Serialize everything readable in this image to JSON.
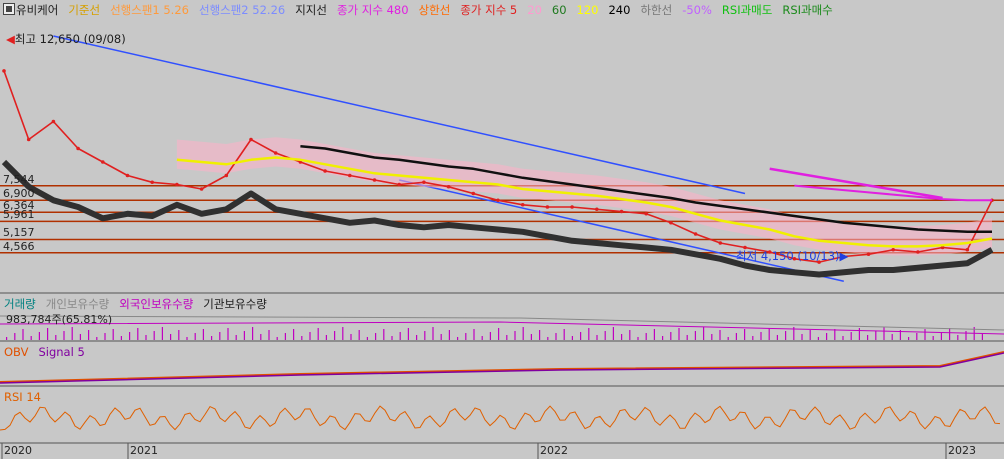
{
  "legend_main": [
    {
      "label": "유비케어",
      "color": "#202020"
    },
    {
      "label": "기준선",
      "color": "#d6a000"
    },
    {
      "label": "선행스팬1 5.26",
      "color": "#ff9a3c"
    },
    {
      "label": "선행스팬2 52.26",
      "color": "#7c8cff"
    },
    {
      "label": "지지선",
      "color": "#202020"
    },
    {
      "label": "종가 지수 480",
      "color": "#e020e0"
    },
    {
      "label": "상한선",
      "color": "#ff6a00"
    },
    {
      "label": "종가 지수 5",
      "color": "#e02020"
    },
    {
      "label": "20",
      "color": "#ff9ad0"
    },
    {
      "label": "60",
      "color": "#1f7a1f"
    },
    {
      "label": "120",
      "color": "#ffff00"
    },
    {
      "label": "240",
      "color": "#000000"
    },
    {
      "label": "하한선",
      "color": "#777777"
    },
    {
      "label": "-50%",
      "color": "#c060ff"
    },
    {
      "label": "RSI과매도",
      "color": "#10c010"
    },
    {
      "label": "RSI과매수",
      "color": "#1a8a1a"
    }
  ],
  "price_levels": [
    "7,544",
    "6,900",
    "6,364",
    "5,961",
    "5,157",
    "4,566"
  ],
  "annotation_high": "최고 12,650 (09/08)",
  "annotation_low": "최저 4,150 (10/13)",
  "legend_volume": [
    {
      "label": "거래량",
      "color": "#008080"
    },
    {
      "label": "개인보유수량",
      "color": "#888888"
    },
    {
      "label": "외국인보유수량",
      "color": "#c000c0"
    },
    {
      "label": "기관보유수량",
      "color": "#202020"
    }
  ],
  "volume_value": "983,784주(65.81%)",
  "legend_obv": [
    {
      "label": "OBV",
      "color": "#e05000"
    },
    {
      "label": "Signal 5",
      "color": "#8000a0"
    }
  ],
  "legend_rsi": [
    {
      "label": "RSI 14",
      "color": "#e06000"
    }
  ],
  "x_axis_labels": [
    "2020",
    "2021",
    "2022",
    "2023"
  ],
  "colors": {
    "background": "#c8c8c8",
    "price_up": "#e02020",
    "price_down": "#2040e0",
    "trend_line": "#3050ff",
    "level_line": "#b03000"
  },
  "chart_data": {
    "type": "line",
    "title": "유비케어",
    "x_axis": [
      "2020",
      "2021",
      "2022",
      "2023"
    ],
    "series": [
      {
        "name": "종가",
        "values": [
          12650,
          9600,
          10400,
          9200,
          8600,
          8000,
          7700,
          7600,
          7400,
          8000,
          9600,
          9000,
          8600,
          8200,
          8000,
          7800,
          7600,
          7700,
          7500,
          7200,
          6900,
          6700,
          6600,
          6600,
          6500,
          6400,
          6300,
          5900,
          5400,
          5000,
          4800,
          4600,
          4300,
          4150,
          4400,
          4500,
          4700,
          4600,
          4800,
          4700,
          6900
        ]
      },
      {
        "name": "240",
        "values": [
          null,
          null,
          null,
          null,
          null,
          null,
          null,
          null,
          null,
          null,
          null,
          null,
          9300,
          9200,
          9000,
          8800,
          8700,
          8550,
          8400,
          8300,
          8100,
          7900,
          7750,
          7600,
          7450,
          7300,
          7150,
          7000,
          6800,
          6650,
          6500,
          6350,
          6200,
          6050,
          5900,
          5800,
          5700,
          5600,
          5550,
          5500,
          5500
        ]
      },
      {
        "name": "120",
        "values": [
          null,
          null,
          null,
          null,
          null,
          null,
          null,
          8700,
          8600,
          8500,
          8700,
          8800,
          8700,
          8500,
          8300,
          8100,
          8000,
          7900,
          7800,
          7700,
          7600,
          7400,
          7300,
          7200,
          7100,
          6950,
          6800,
          6600,
          6300,
          6000,
          5800,
          5600,
          5300,
          5100,
          5000,
          4900,
          4850,
          4850,
          4900,
          5000,
          5200
        ]
      },
      {
        "name": "종가 지수 480",
        "values": [
          null,
          null,
          null,
          null,
          null,
          null,
          null,
          null,
          null,
          null,
          null,
          null,
          null,
          null,
          null,
          null,
          null,
          null,
          null,
          null,
          null,
          null,
          null,
          null,
          null,
          null,
          null,
          null,
          null,
          null,
          null,
          null,
          7550,
          7450,
          7350,
          7250,
          7150,
          7050,
          6950,
          6900,
          6900
        ]
      },
      {
        "name": "지지선",
        "values": [
          8600,
          7500,
          6900,
          6600,
          6100,
          6300,
          6200,
          6700,
          6300,
          6500,
          7200,
          6500,
          6300,
          6100,
          5900,
          6000,
          5800,
          5700,
          5800,
          5700,
          5600,
          5500,
          5300,
          5100,
          5000,
          4900,
          4800,
          4700,
          4500,
          4300,
          4000,
          3800,
          3700,
          3600,
          3700,
          3800,
          3800,
          3900,
          4000,
          4100,
          4700
        ]
      }
    ],
    "level_lines": [
      7544,
      6900,
      6364,
      5961,
      5157,
      4566
    ],
    "high": {
      "value": 12650,
      "label": "최고 12,650 (09/08)"
    },
    "low": {
      "value": 4150,
      "label": "최저 4,150 (10/13)"
    },
    "panels": [
      {
        "name": "거래량",
        "readout": "983,784주(65.81%)"
      },
      {
        "name": "OBV",
        "signal": "Signal 5"
      },
      {
        "name": "RSI 14",
        "range": [
          0,
          100
        ]
      }
    ]
  }
}
